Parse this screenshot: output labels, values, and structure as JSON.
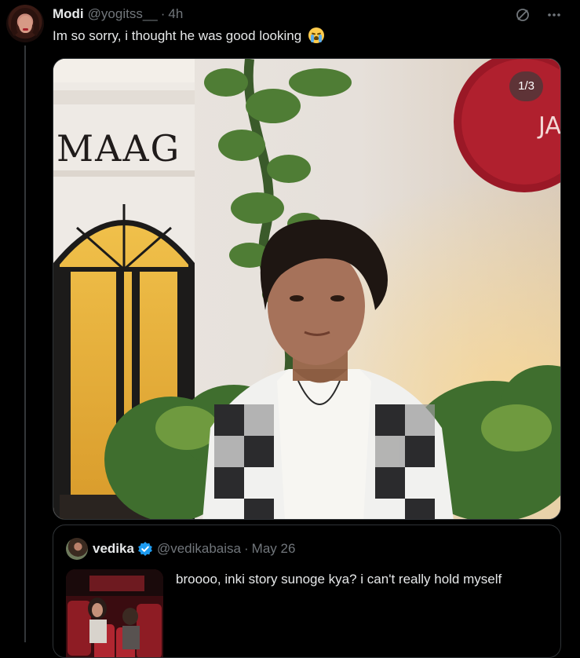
{
  "post": {
    "author_name": "Modi",
    "author_handle": "@yogitss__",
    "separator": "·",
    "time": "4h",
    "text": "Im so sorry, i thought he was good looking",
    "emoji_name": "loudly-crying-face",
    "icons": [
      "grok-icon",
      "more-icon"
    ],
    "media_counter": "1/3",
    "media_signage": "MAAG"
  },
  "quoted_post": {
    "author_name": "vedika",
    "verified": true,
    "author_handle": "@vedikabaisa",
    "separator": "·",
    "date": "May 26",
    "text": "broooo, inki story sunoge kya? i can't really hold myself"
  },
  "colors": {
    "background": "#000000",
    "text_primary": "#e7e9ea",
    "text_secondary": "#71767b",
    "border": "#2f3336",
    "verified_blue": "#1d9bf0"
  }
}
